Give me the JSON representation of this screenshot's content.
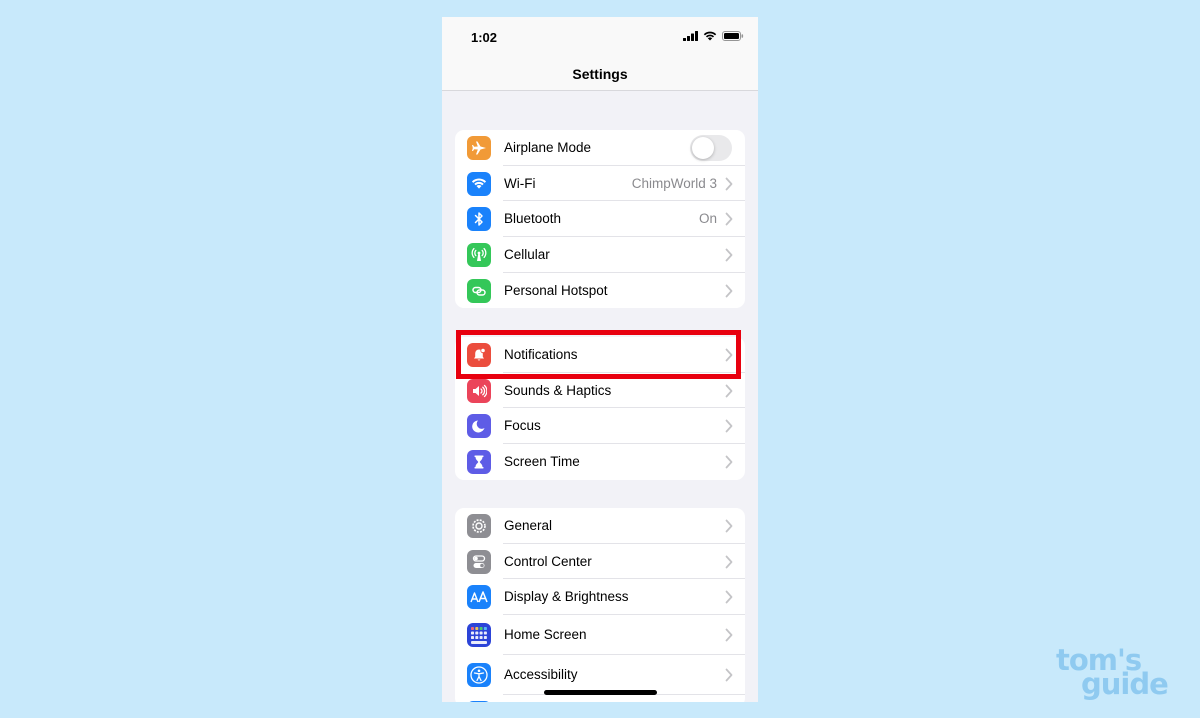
{
  "status_bar": {
    "time": "1:02"
  },
  "nav": {
    "title": "Settings"
  },
  "groups": [
    [
      {
        "label": "Airplane Mode",
        "icon": "airplane-icon",
        "color": "#f19a37",
        "control": "toggle",
        "toggle_on": false
      },
      {
        "label": "Wi-Fi",
        "icon": "wifi-icon",
        "color": "#1a82fb",
        "value": "ChimpWorld 3"
      },
      {
        "label": "Bluetooth",
        "icon": "bluetooth-icon",
        "color": "#1a82fb",
        "value": "On"
      },
      {
        "label": "Cellular",
        "icon": "cellular-icon",
        "color": "#34c759"
      },
      {
        "label": "Personal Hotspot",
        "icon": "hotspot-icon",
        "color": "#34c759"
      }
    ],
    [
      {
        "label": "Notifications",
        "icon": "notifications-icon",
        "color": "#eb4d3d"
      },
      {
        "label": "Sounds & Haptics",
        "icon": "speaker-icon",
        "color": "#eb445a"
      },
      {
        "label": "Focus",
        "icon": "moon-icon",
        "color": "#5e5ce6"
      },
      {
        "label": "Screen Time",
        "icon": "hourglass-icon",
        "color": "#5e5ce6"
      }
    ],
    [
      {
        "label": "General",
        "icon": "gear-icon",
        "color": "#8e8e93"
      },
      {
        "label": "Control Center",
        "icon": "switches-icon",
        "color": "#8e8e93"
      },
      {
        "label": "Display & Brightness",
        "icon": "text-size-icon",
        "color": "#1a82fb"
      },
      {
        "label": "Home Screen",
        "icon": "home-grid-icon",
        "color": "#2c44d8"
      },
      {
        "label": "Accessibility",
        "icon": "accessibility-icon",
        "color": "#1a82fb"
      }
    ]
  ],
  "highlight": {
    "target": "Notifications",
    "color": "#e8000f"
  },
  "watermark": {
    "line1": "tom's",
    "line2": "guide"
  }
}
